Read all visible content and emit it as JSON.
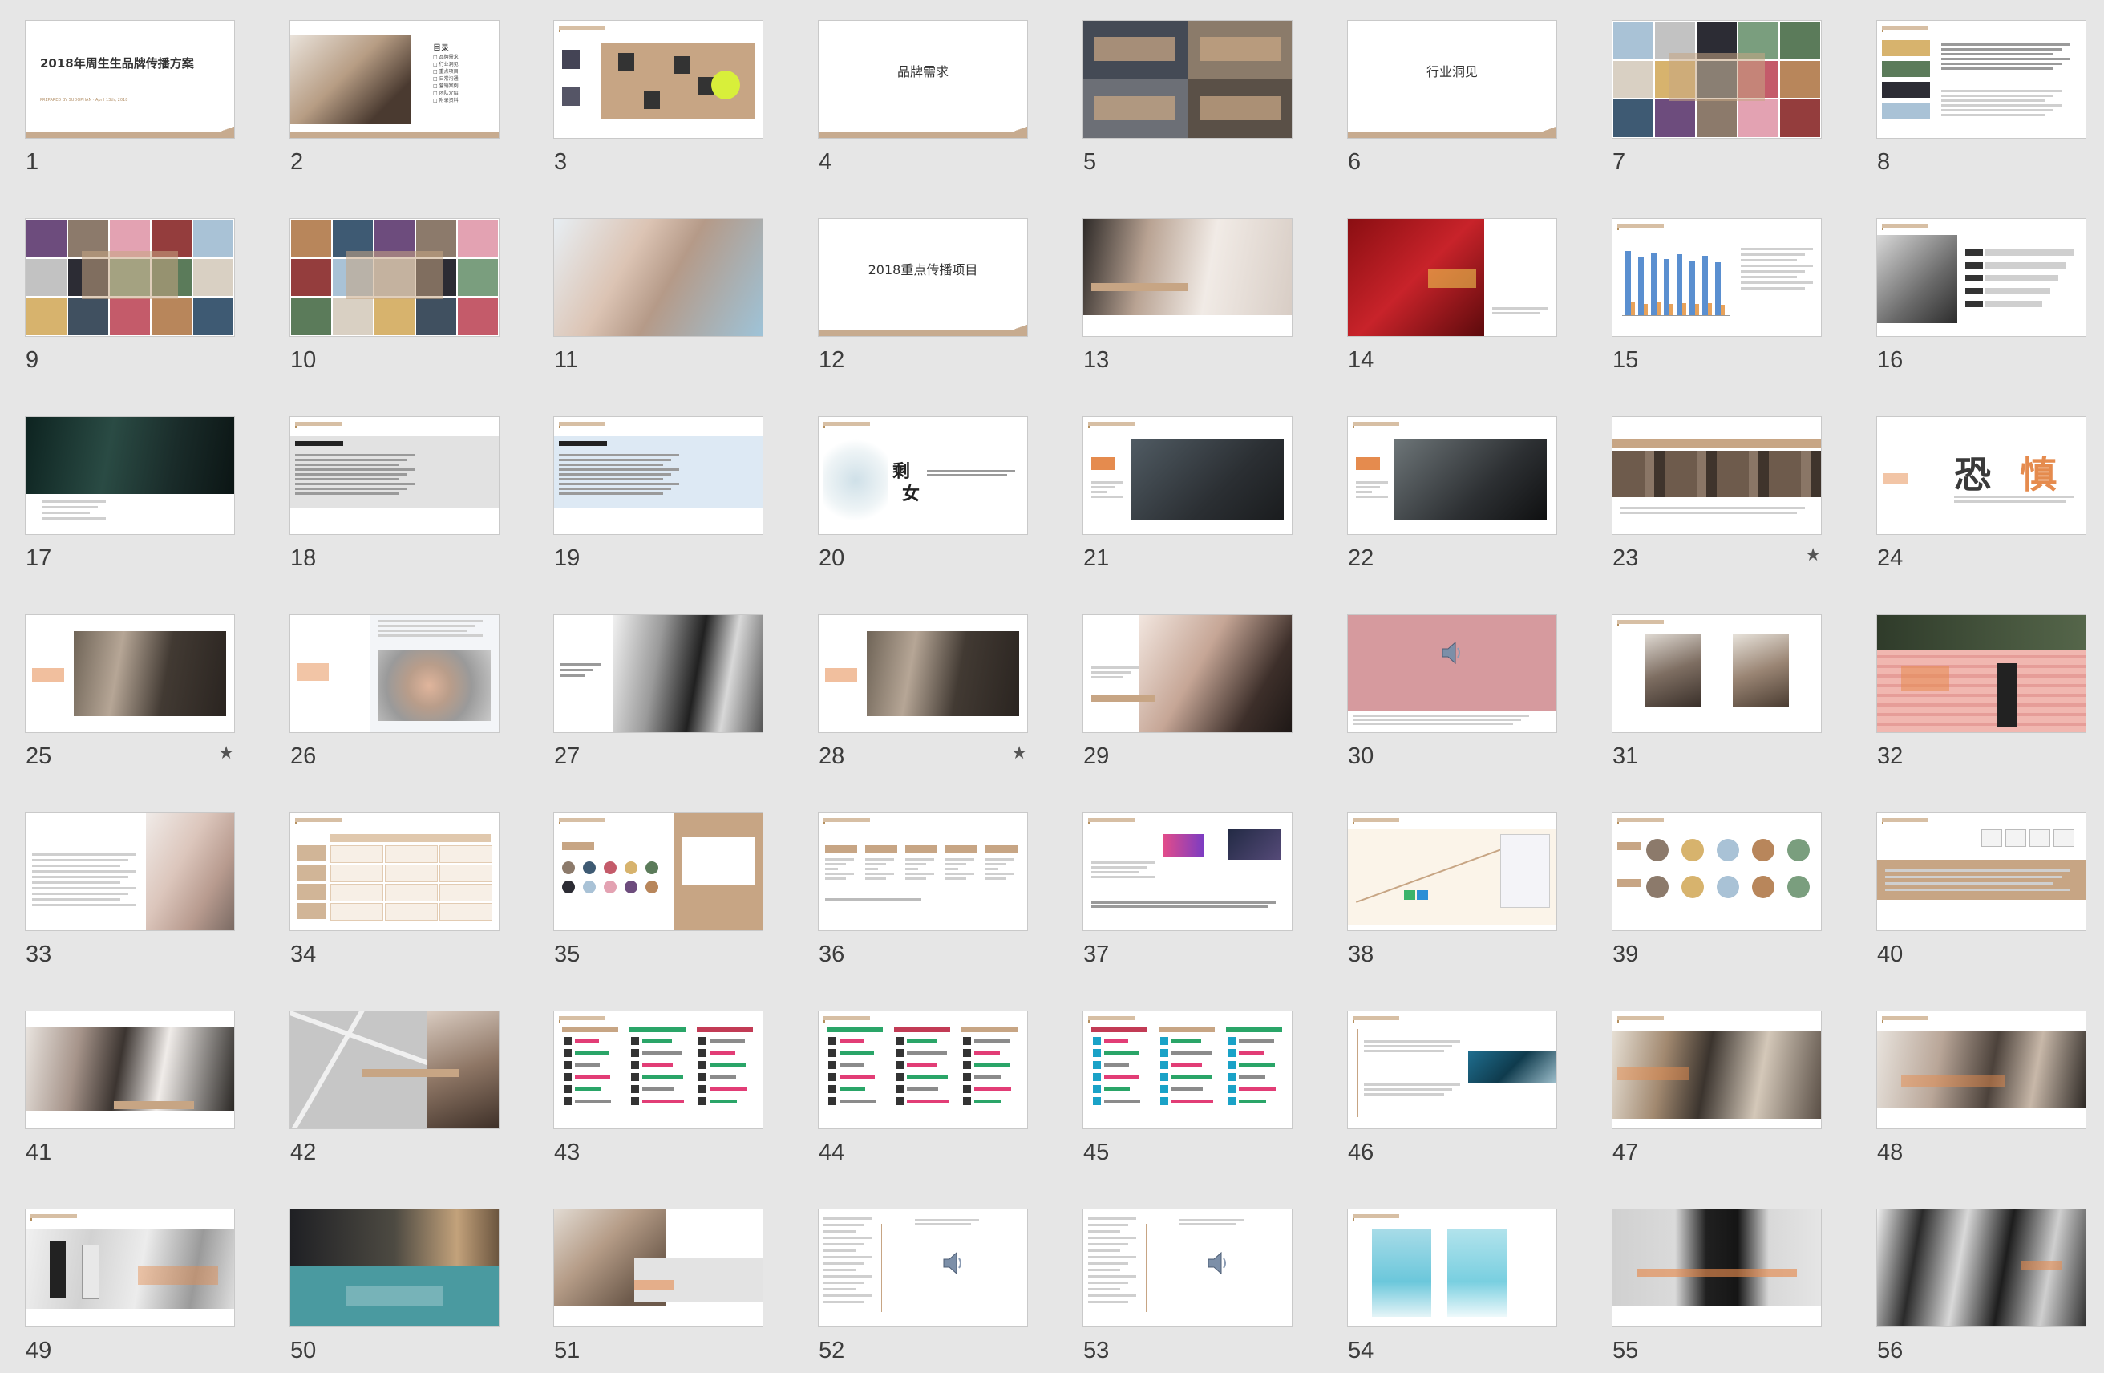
{
  "slides": [
    {
      "num": "1",
      "title": "2018年周生生品牌传播方案",
      "subtitle": "PREPARED BY SUDOPHAN · April 13th, 2018",
      "kind": "title"
    },
    {
      "num": "2",
      "kind": "toc",
      "toc_title": "目录",
      "toc_items": [
        "品牌需求",
        "行业洞见",
        "重点项目",
        "日常沟通",
        "营销案例",
        "团队介绍",
        "附录资料"
      ]
    },
    {
      "num": "3",
      "kind": "team"
    },
    {
      "num": "4",
      "kind": "section",
      "title": "品牌需求"
    },
    {
      "num": "5",
      "kind": "mosaic4"
    },
    {
      "num": "6",
      "kind": "section",
      "title": "行业洞见"
    },
    {
      "num": "7",
      "kind": "collage"
    },
    {
      "num": "8",
      "kind": "textlist"
    },
    {
      "num": "9",
      "kind": "collage"
    },
    {
      "num": "10",
      "kind": "collage"
    },
    {
      "num": "11",
      "kind": "photo-face"
    },
    {
      "num": "12",
      "kind": "section",
      "title": "2018重点传播项目"
    },
    {
      "num": "13",
      "kind": "photo-banner"
    },
    {
      "num": "14",
      "kind": "red-photo"
    },
    {
      "num": "15",
      "kind": "barchart"
    },
    {
      "num": "16",
      "kind": "photo-bars"
    },
    {
      "num": "17",
      "kind": "dark-scene"
    },
    {
      "num": "18",
      "kind": "textbox"
    },
    {
      "num": "19",
      "kind": "textbox-blue"
    },
    {
      "num": "20",
      "kind": "calligraphy",
      "chars": [
        "剩",
        "女"
      ]
    },
    {
      "num": "21",
      "kind": "video"
    },
    {
      "num": "22",
      "kind": "video2"
    },
    {
      "num": "23",
      "kind": "strip",
      "star": "★"
    },
    {
      "num": "24",
      "kind": "bigchars",
      "chars": [
        "恐",
        "慎"
      ]
    },
    {
      "num": "25",
      "kind": "interview",
      "star": "★"
    },
    {
      "num": "26",
      "kind": "monkey"
    },
    {
      "num": "27",
      "kind": "bw-portrait"
    },
    {
      "num": "28",
      "kind": "interview",
      "star": "★"
    },
    {
      "num": "29",
      "kind": "hands"
    },
    {
      "num": "30",
      "kind": "audio-pink"
    },
    {
      "num": "31",
      "kind": "fashion"
    },
    {
      "num": "32",
      "kind": "wall"
    },
    {
      "num": "33",
      "kind": "smile"
    },
    {
      "num": "34",
      "kind": "table"
    },
    {
      "num": "35",
      "kind": "logos"
    },
    {
      "num": "36",
      "kind": "flow"
    },
    {
      "num": "37",
      "kind": "media"
    },
    {
      "num": "38",
      "kind": "timeline"
    },
    {
      "num": "39",
      "kind": "kol"
    },
    {
      "num": "40",
      "kind": "tan-band"
    },
    {
      "num": "41",
      "kind": "photo-banner2"
    },
    {
      "num": "42",
      "kind": "map"
    },
    {
      "num": "43",
      "kind": "infographic"
    },
    {
      "num": "44",
      "kind": "infographic2"
    },
    {
      "num": "45",
      "kind": "infographic3"
    },
    {
      "num": "46",
      "kind": "timeline2"
    },
    {
      "num": "47",
      "kind": "street"
    },
    {
      "num": "48",
      "kind": "couple"
    },
    {
      "num": "49",
      "kind": "walking"
    },
    {
      "num": "50",
      "kind": "city"
    },
    {
      "num": "51",
      "kind": "girls"
    },
    {
      "num": "52",
      "kind": "audio-text"
    },
    {
      "num": "53",
      "kind": "audio-text"
    },
    {
      "num": "54",
      "kind": "cyan-cards"
    },
    {
      "num": "55",
      "kind": "model-dark"
    },
    {
      "num": "56",
      "kind": "bw-glasses"
    }
  ],
  "icons": {
    "star": "star-icon",
    "speaker": "speaker-icon"
  },
  "colors": {
    "background": "#e6e6e6",
    "accent": "#c7ab8f",
    "orange": "#e58b4e"
  }
}
